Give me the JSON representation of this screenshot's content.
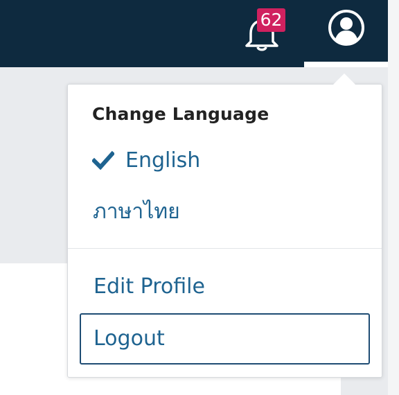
{
  "header": {
    "notifications_count": "62",
    "bell_icon": "bell-icon",
    "profile_icon": "user-circle-icon"
  },
  "menu": {
    "section_title": "Change Language",
    "languages": [
      {
        "label": "English",
        "selected": true,
        "icon": "check-icon"
      },
      {
        "label": "ภาษาไทย",
        "selected": false
      }
    ],
    "edit_profile": "Edit Profile",
    "logout": "Logout"
  },
  "colors": {
    "header_bg": "#0e2a3f",
    "badge_bg": "#d0215f",
    "link": "#1e6390",
    "focus_border": "#1e4c73"
  }
}
